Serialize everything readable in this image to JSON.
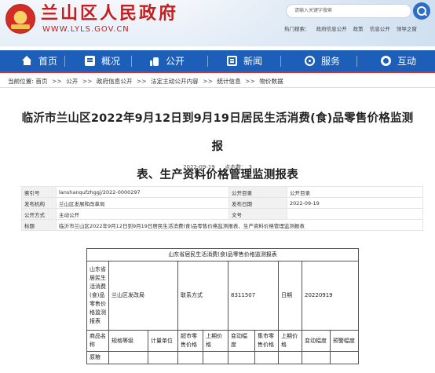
{
  "header": {
    "site_name": "兰山区人民政府",
    "site_url": "WWW.LYLS.GOV.CN",
    "search_placeholder": "请输入关键字搜索",
    "quick_links": [
      "热门搜索：",
      "政府信息公开",
      "政策",
      "信息公开",
      "领导之窗"
    ]
  },
  "nav": {
    "items": [
      {
        "label": "首页",
        "icon": "home-icon"
      },
      {
        "label": "概况",
        "icon": "overview-icon"
      },
      {
        "label": "公开",
        "icon": "public-icon"
      },
      {
        "label": "新闻",
        "icon": "news-icon"
      },
      {
        "label": "服务",
        "icon": "service-icon"
      },
      {
        "label": "互动",
        "icon": "interact-icon"
      }
    ]
  },
  "breadcrumb": {
    "prefix": "当前位置:",
    "items": [
      "首页",
      "公开",
      "政府信息公开",
      "法定主动公开内容",
      "统计信息",
      "物价数据"
    ]
  },
  "article": {
    "title_line1": "临沂市兰山区2022年9月12日到9月19日居民生活消费(食)品零售价格监测报",
    "title_line2": "表、生产资料价格管理监测报表",
    "date": "2022-09-19",
    "hits_label": "点击数：",
    "hits": "3"
  },
  "info_table": {
    "index_no_label": "索引号",
    "index_no": "lanshanqufzhggj/2022-0000297",
    "catalog_label": "公开目录",
    "catalog": "公开目录",
    "issuer_label": "发布机构",
    "issuer": "兰山区发展和改革局",
    "pub_date_label": "发布日期",
    "pub_date": "2022-09-19",
    "method_label": "公开方式",
    "method": "主动公开",
    "doc_no_label": "文号",
    "doc_no": "",
    "title_label": "标题",
    "title": "临沂市兰山区2022年9月12日到9月19日居民生活消费(食)品零售价格监测报表、生产资料价格管理监测报表"
  },
  "price_table": {
    "title": "山东省居民生活消费(食)品零售价格监测报表",
    "form_name": "山东省居民生活消费(食)品零售价格监测报表",
    "agency": "兰山区发改局",
    "contact_label": "联系方式",
    "contact": "8311507",
    "date_label": "日期",
    "date": "20220919",
    "headers": [
      "商品名称",
      "规格等级",
      "计量单位",
      "超市零售价格",
      "上期价格",
      "变动幅度",
      "集市零售价格",
      "上期价格",
      "变动幅度",
      "预警幅度"
    ],
    "first_row_label": "原粮"
  },
  "colors": {
    "brand_red": "#c41e1e",
    "nav_blue": "#1d5eb9"
  }
}
